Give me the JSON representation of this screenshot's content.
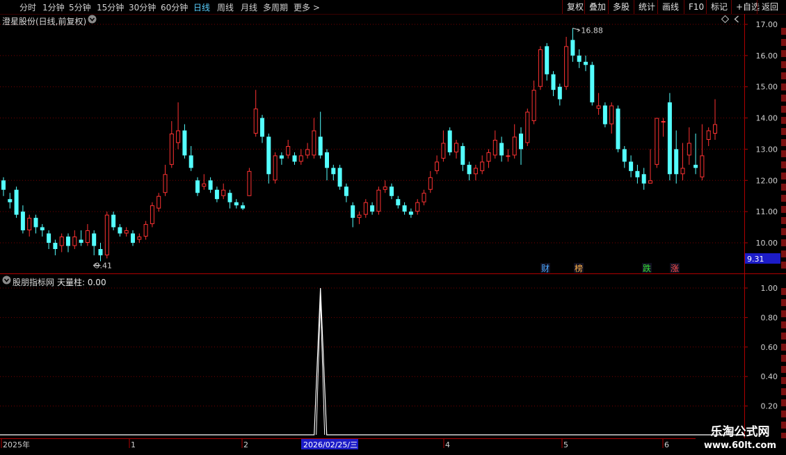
{
  "toolbar": {
    "periods": [
      "分时",
      "1分钟",
      "5分钟",
      "15分钟",
      "30分钟",
      "60分钟",
      "日线",
      "周线",
      "月线",
      "多周期",
      "更多 >"
    ],
    "active_period": "日线",
    "right_buttons": [
      "复权",
      "叠加",
      "多股",
      "统计",
      "画线",
      "F10",
      "标记",
      "+自选",
      "返回"
    ]
  },
  "main": {
    "title": "澄星股份(日线,前复权)",
    "price_axis": [
      "17.00",
      "16.00",
      "15.00",
      "14.00",
      "13.00",
      "12.00",
      "11.00",
      "10.00"
    ],
    "current_price_tag": "9.31",
    "high_marker": "16.88",
    "low_marker": "9.41",
    "event_markers": [
      {
        "label": "财",
        "color": "#4aa8ff"
      },
      {
        "label": "榜",
        "color": "#ffb24a"
      },
      {
        "label": "跌",
        "color": "#36e036"
      },
      {
        "label": "涨",
        "color": "#ff5050"
      }
    ]
  },
  "sub": {
    "title": "股朋指标网",
    "indicator": "天量柱: 0.00",
    "axis": [
      "1.00",
      "0.80",
      "0.60",
      "0.40",
      "0.20"
    ]
  },
  "timeline": {
    "labels": [
      "2025年",
      "1",
      "2",
      "4",
      "5",
      "6"
    ],
    "cursor_date": "2026/02/25/三"
  },
  "watermark": {
    "name": "乐淘公式网",
    "url": "www.60lt.com"
  },
  "colors": {
    "up": "#ff3232",
    "down": "#54ffff",
    "grid": "#7a0000",
    "border": "#b00000"
  },
  "chart_data": {
    "type": "candlestick",
    "ylim": [
      9.31,
      17.2
    ],
    "candles": [
      [
        12.0,
        11.7,
        12.1,
        11.5
      ],
      [
        11.4,
        11.3,
        11.6,
        11.1
      ],
      [
        11.7,
        10.9,
        11.8,
        10.8
      ],
      [
        11.0,
        10.4,
        11.2,
        10.3
      ],
      [
        10.4,
        10.8,
        10.9,
        10.2
      ],
      [
        10.8,
        10.5,
        10.9,
        10.3
      ],
      [
        10.5,
        10.4,
        10.6,
        10.2
      ],
      [
        10.3,
        10.0,
        10.4,
        9.8
      ],
      [
        10.0,
        9.8,
        10.1,
        9.6
      ],
      [
        9.9,
        10.2,
        10.3,
        9.7
      ],
      [
        10.2,
        9.9,
        10.3,
        9.7
      ],
      [
        9.9,
        10.2,
        10.4,
        9.8
      ],
      [
        10.1,
        10.0,
        10.4,
        9.9
      ],
      [
        10.0,
        10.4,
        10.6,
        9.9
      ],
      [
        10.3,
        9.9,
        10.4,
        9.6
      ],
      [
        9.8,
        9.6,
        10.0,
        9.41
      ],
      [
        9.6,
        10.9,
        11.0,
        9.5
      ],
      [
        10.9,
        10.5,
        11.0,
        10.4
      ],
      [
        10.5,
        10.3,
        10.6,
        10.2
      ],
      [
        10.3,
        10.4,
        10.5,
        10.2
      ],
      [
        10.3,
        10.0,
        10.4,
        9.9
      ],
      [
        10.1,
        10.2,
        10.3,
        10.0
      ],
      [
        10.2,
        10.6,
        10.7,
        10.1
      ],
      [
        10.6,
        11.2,
        11.3,
        10.5
      ],
      [
        11.1,
        11.5,
        11.6,
        11.0
      ],
      [
        11.6,
        12.2,
        12.5,
        11.5
      ],
      [
        12.5,
        13.5,
        13.9,
        12.4
      ],
      [
        13.2,
        13.6,
        14.5,
        13.0
      ],
      [
        13.6,
        12.8,
        13.8,
        12.7
      ],
      [
        12.8,
        12.4,
        13.1,
        12.3
      ],
      [
        12.0,
        11.6,
        12.1,
        11.5
      ],
      [
        11.8,
        11.9,
        12.2,
        11.7
      ],
      [
        12.0,
        11.7,
        12.1,
        11.6
      ],
      [
        11.7,
        11.4,
        11.8,
        11.3
      ],
      [
        11.5,
        11.7,
        11.9,
        11.4
      ],
      [
        11.6,
        11.3,
        11.7,
        11.1
      ],
      [
        11.3,
        11.2,
        11.4,
        11.1
      ],
      [
        11.2,
        11.1,
        11.3,
        11.05
      ],
      [
        11.5,
        12.3,
        12.4,
        11.5
      ],
      [
        13.5,
        14.3,
        14.9,
        13.4
      ],
      [
        14.0,
        13.4,
        14.1,
        13.2
      ],
      [
        13.4,
        12.2,
        13.5,
        11.9
      ],
      [
        12.0,
        12.8,
        12.9,
        11.9
      ],
      [
        12.8,
        12.7,
        12.9,
        12.5
      ],
      [
        12.8,
        13.1,
        13.3,
        12.7
      ],
      [
        12.8,
        12.6,
        12.9,
        12.5
      ],
      [
        12.6,
        12.8,
        13.0,
        12.5
      ],
      [
        12.8,
        13.0,
        13.2,
        12.7
      ],
      [
        12.8,
        13.6,
        14.0,
        12.7
      ],
      [
        13.4,
        12.8,
        14.2,
        12.7
      ],
      [
        12.9,
        12.4,
        13.0,
        12.0
      ],
      [
        12.4,
        12.2,
        12.5,
        12.0
      ],
      [
        12.4,
        11.8,
        12.5,
        11.7
      ],
      [
        11.8,
        11.5,
        11.9,
        11.3
      ],
      [
        11.2,
        10.8,
        11.3,
        10.5
      ],
      [
        10.8,
        10.9,
        11.0,
        10.6
      ],
      [
        10.9,
        11.3,
        11.4,
        10.8
      ],
      [
        11.2,
        11.0,
        11.3,
        10.9
      ],
      [
        11.0,
        11.7,
        11.8,
        10.9
      ],
      [
        11.7,
        11.8,
        12.0,
        11.6
      ],
      [
        11.8,
        11.5,
        11.9,
        11.4
      ],
      [
        11.4,
        11.2,
        11.5,
        11.1
      ],
      [
        11.2,
        11.0,
        11.3,
        10.9
      ],
      [
        11.0,
        10.9,
        11.1,
        10.8
      ],
      [
        11.0,
        11.3,
        11.4,
        10.9
      ],
      [
        11.3,
        11.6,
        11.7,
        11.2
      ],
      [
        11.7,
        12.1,
        12.3,
        11.6
      ],
      [
        12.3,
        12.6,
        12.8,
        12.2
      ],
      [
        12.7,
        13.2,
        13.6,
        12.6
      ],
      [
        13.6,
        12.9,
        13.7,
        12.8
      ],
      [
        12.9,
        13.2,
        13.3,
        12.7
      ],
      [
        13.1,
        12.5,
        13.2,
        12.3
      ],
      [
        12.5,
        12.2,
        12.6,
        12.0
      ],
      [
        12.2,
        12.4,
        12.5,
        12.0
      ],
      [
        12.3,
        12.6,
        12.8,
        12.2
      ],
      [
        12.6,
        12.9,
        13.0,
        12.4
      ],
      [
        12.8,
        13.3,
        13.6,
        12.7
      ],
      [
        13.2,
        12.8,
        13.4,
        12.6
      ],
      [
        12.8,
        12.8,
        13.0,
        12.6
      ],
      [
        12.8,
        13.4,
        13.8,
        12.7
      ],
      [
        13.5,
        13.0,
        13.7,
        12.5
      ],
      [
        13.2,
        14.2,
        14.3,
        13.1
      ],
      [
        13.9,
        14.9,
        15.2,
        13.8
      ],
      [
        15.0,
        16.2,
        16.3,
        14.9
      ],
      [
        16.3,
        15.4,
        16.4,
        15.2
      ],
      [
        15.4,
        14.9,
        15.5,
        14.7
      ],
      [
        15.0,
        14.6,
        15.1,
        14.4
      ],
      [
        15.0,
        16.3,
        16.6,
        14.9
      ],
      [
        16.5,
        16.0,
        16.88,
        15.8
      ],
      [
        16.0,
        15.8,
        16.2,
        15.6
      ],
      [
        15.8,
        15.7,
        16.0,
        15.5
      ],
      [
        15.7,
        14.5,
        15.8,
        14.4
      ],
      [
        14.3,
        14.4,
        14.8,
        14.1
      ],
      [
        14.4,
        13.8,
        14.5,
        13.7
      ],
      [
        13.8,
        14.4,
        14.5,
        13.5
      ],
      [
        14.3,
        13.0,
        14.4,
        12.9
      ],
      [
        13.0,
        12.6,
        13.1,
        12.4
      ],
      [
        12.6,
        12.3,
        12.8,
        12.1
      ],
      [
        12.3,
        12.1,
        12.5,
        11.9
      ],
      [
        12.2,
        11.9,
        12.4,
        11.7
      ],
      [
        11.9,
        12.0,
        13.0,
        11.9
      ],
      [
        12.5,
        14.0,
        14.0,
        12.4
      ],
      [
        13.9,
        13.9,
        14.0,
        13.4
      ],
      [
        14.5,
        12.2,
        14.8,
        12.0
      ],
      [
        13.0,
        12.2,
        13.6,
        11.9
      ],
      [
        12.2,
        12.4,
        13.2,
        12.0
      ],
      [
        12.8,
        13.2,
        13.7,
        12.5
      ],
      [
        12.5,
        12.4,
        13.5,
        12.2
      ],
      [
        12.1,
        12.8,
        13.8,
        12.0
      ],
      [
        13.3,
        13.6,
        13.7,
        13.1
      ],
      [
        13.5,
        13.8,
        14.6,
        13.3
      ]
    ],
    "indicator_series": {
      "name": "天量柱",
      "spike_index": 49,
      "spike_value": 1.0,
      "ylim": [
        0,
        1.0
      ]
    }
  }
}
